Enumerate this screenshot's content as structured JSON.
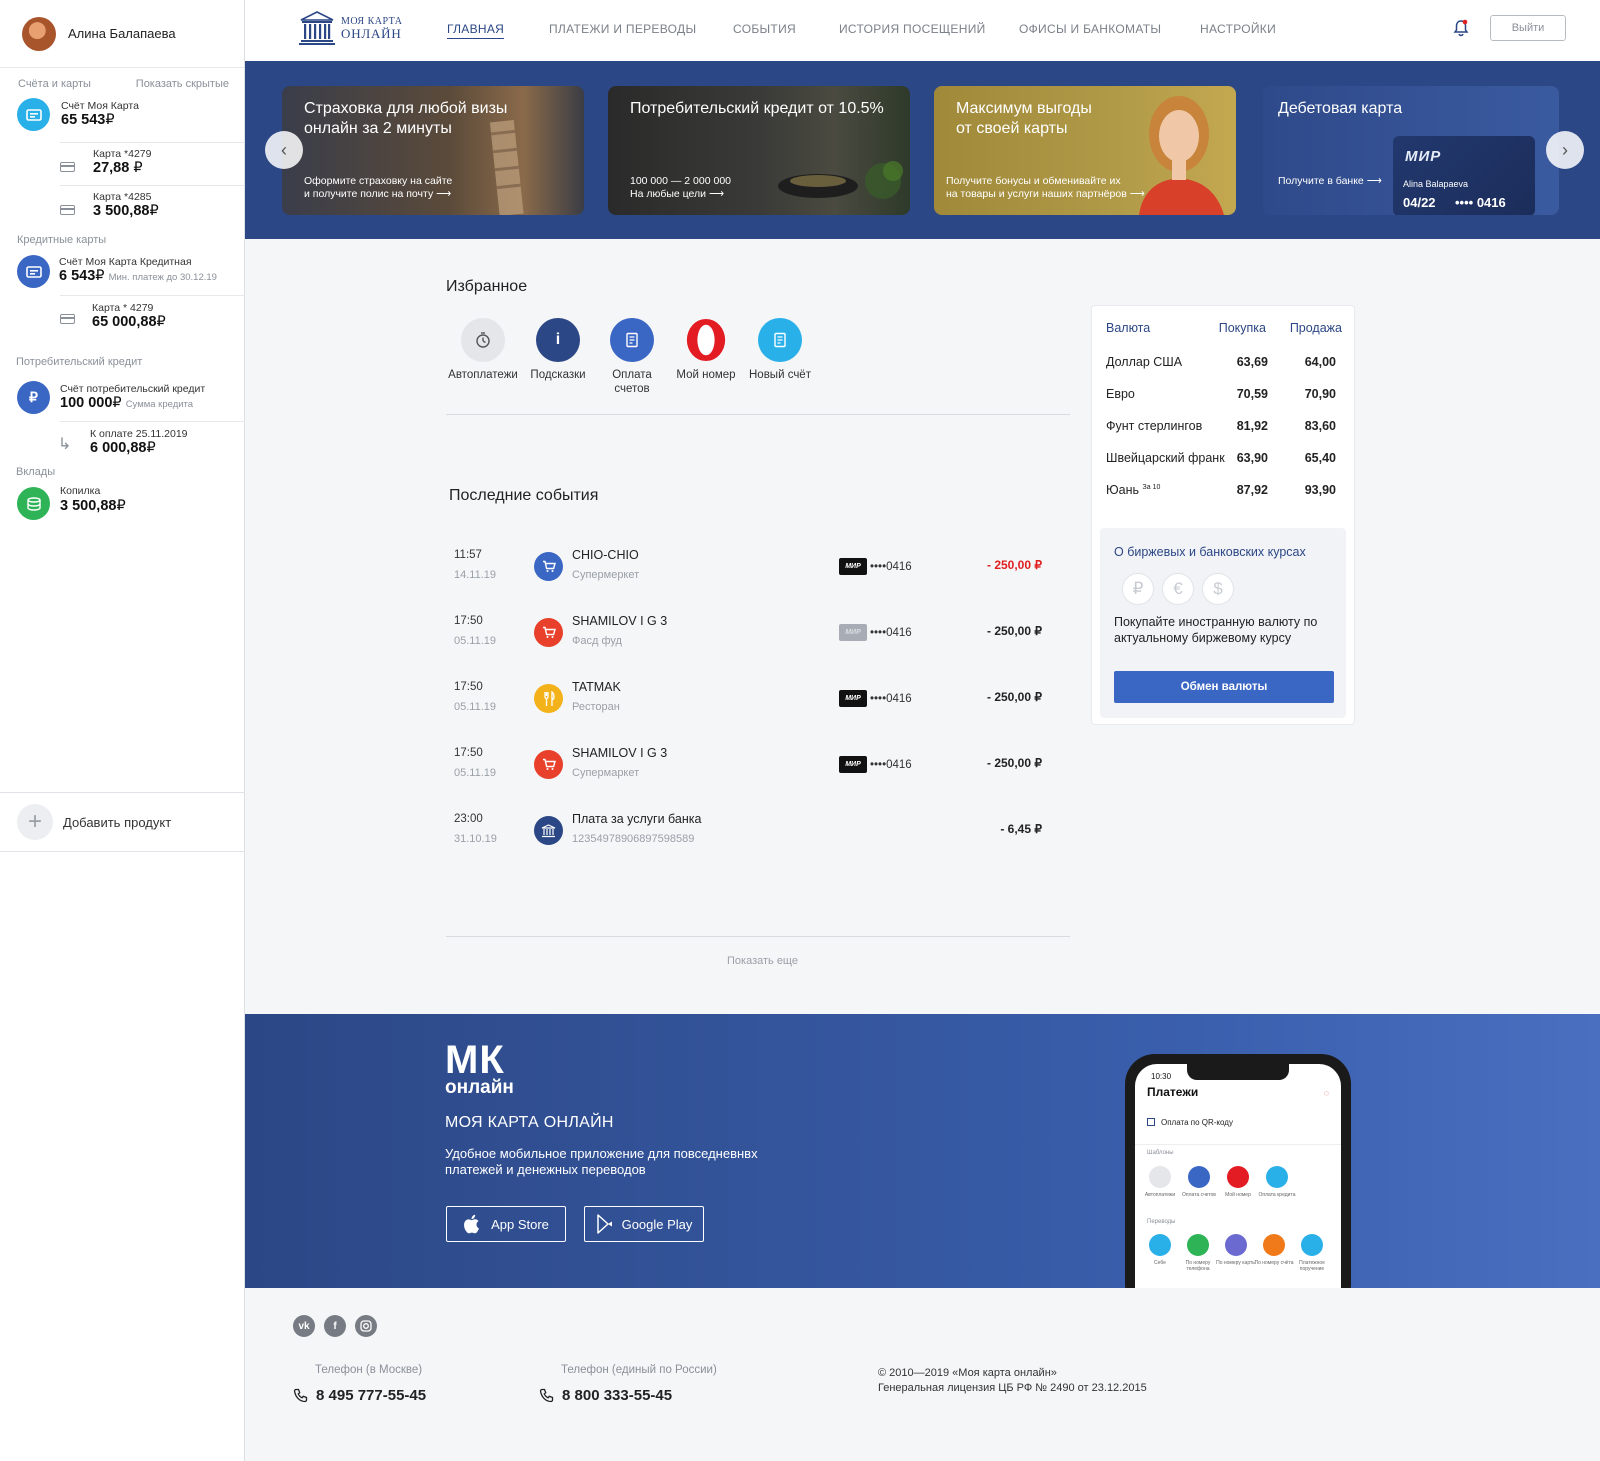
{
  "profile": {
    "name": "Алина Балапаева"
  },
  "sidebar": {
    "accounts_header": "Счёта и карты",
    "show_hidden": "Показать скрытые",
    "main_account": {
      "title": "Счёт Моя Карта",
      "amount": "65 543"
    },
    "cards": [
      {
        "title": "Карта *4279",
        "amount": "27,88"
      },
      {
        "title": "Карта *4285",
        "amount": "3 500,88"
      }
    ],
    "credit_header": "Кредитные карты",
    "credit_account": {
      "title": "Счёт Моя Карта Кредитная",
      "amount": "6 543",
      "note": "Мин. платеж до 30.12.19"
    },
    "credit_card": {
      "title": "Карта * 4279",
      "amount": "65 000,88"
    },
    "loan_header": "Потребительский кредит",
    "loan_account": {
      "title": "Счёт потребительский кредит",
      "amount": "100 000",
      "note": "Сумма кредита"
    },
    "loan_payment": {
      "title": "К оплате 25.11.2019",
      "amount": "6 000,88"
    },
    "deposits_header": "Вклады",
    "deposit": {
      "title": "Копилка",
      "amount": "3 500,88"
    },
    "add_product": "Добавить продукт",
    "currency_symbol": "₽"
  },
  "nav": {
    "logo_line1": "МОЯ КАРТА",
    "logo_line2": "ОНЛАЙН",
    "items": [
      "ГЛАВНАЯ",
      "ПЛАТЕЖИ И ПЕРЕВОДЫ",
      "СОБЫТИЯ",
      "ИСТОРИЯ ПОСЕЩЕНИЙ",
      "ОФИСЫ И БАНКОМАТЫ",
      "НАСТРОЙКИ"
    ],
    "logout": "Выйти"
  },
  "banners": [
    {
      "title": "Страховка для любой визы онлайн за 2 минуты",
      "sub1": "Оформите страховку на сайте",
      "sub2": "и получите полис на почту"
    },
    {
      "title": "Потребительский кредит от 10.5%",
      "sub1": "100 000 — 2 000 000",
      "sub2": "На любые цели"
    },
    {
      "title1": "Максимум выгоды",
      "title2": "от своей карты",
      "sub1": "Получите бонусы и обменивайте их",
      "sub2": "на товары и услуги наших партнёров"
    },
    {
      "title": "Дебетовая карта",
      "sub1": "Получите в банке",
      "card_brand": "МИР",
      "card_holder": "Alina Balapaeva",
      "card_exp": "04/22",
      "card_num": "•••• 0416"
    }
  ],
  "favorites": {
    "title": "Избранное",
    "items": [
      {
        "label": "Автоплатежи",
        "color": "#e4e6ea"
      },
      {
        "label": "Подсказки",
        "color": "#2c4785"
      },
      {
        "label": "Оплата счетов",
        "color": "#3a66c4"
      },
      {
        "label": "Мой номер",
        "color": "#e31b23"
      },
      {
        "label": "Новый счёт",
        "color": "#2ab0e8"
      }
    ]
  },
  "events": {
    "title": "Последние события",
    "items": [
      {
        "time": "11:57",
        "date": "14.11.19",
        "name": "CHIO-CHIO",
        "category": "Супермеркет",
        "card": "••••0416",
        "amount": "- 250,00 ₽",
        "color": "#3a66c4"
      },
      {
        "time": "17:50",
        "date": "05.11.19",
        "name": "SHAMILOV I G 3",
        "category": "Фасд фуд",
        "card": "••••0416",
        "amount": "- 250,00 ₽",
        "color": "#e8402a"
      },
      {
        "time": "17:50",
        "date": "05.11.19",
        "name": "TATMAK",
        "category": "Ресторан",
        "card": "••••0416",
        "amount": "- 250,00 ₽",
        "color": "#f4b21a"
      },
      {
        "time": "17:50",
        "date": "05.11.19",
        "name": "SHAMILOV I G 3",
        "category": "Супермаркет",
        "card": "••••0416",
        "amount": "- 250,00 ₽",
        "color": "#e8402a"
      },
      {
        "time": "23:00",
        "date": "31.10.19",
        "name": "Плата за услуги банка",
        "category": "12354978906897598589",
        "card": "",
        "amount": "- 6,45 ₽",
        "color": "#2c4785"
      }
    ],
    "card_brand": "МИР",
    "show_more": "Показать еще"
  },
  "currency": {
    "head_currency": "Валюта",
    "head_buy": "Покупка",
    "head_sell": "Продажа",
    "rows": [
      {
        "name": "Доллар США",
        "buy": "63,69",
        "sell": "64,00"
      },
      {
        "name": "Евро",
        "buy": "70,59",
        "sell": "70,90"
      },
      {
        "name": "Фунт стерлингов",
        "buy": "81,92",
        "sell": "83,60"
      },
      {
        "name": "Швейцарский франк",
        "buy": "63,90",
        "sell": "65,40"
      },
      {
        "name": "Юань",
        "note": "За 10",
        "buy": "87,92",
        "sell": "93,90"
      }
    ],
    "info_title": "О биржевых и банковских курсах",
    "info_text": "Покупайте иностранную валюту по актуальному биржевому курсу",
    "button": "Обмен валюты"
  },
  "app_promo": {
    "logo_big": "МК",
    "logo_small": "онлайн",
    "title": "МОЯ КАРТА ОНЛАЙН",
    "desc1": "Удобное мобильное  приложение для повседневнвх",
    "desc2": "платежей и денежных переводов",
    "app_store": "App Store",
    "google_play": "Google Play",
    "phone": {
      "time": "10:30",
      "title": "Платежи",
      "qr": "Оплата по QR-коду",
      "templates": "Шаблоны",
      "template_items": [
        "Автоплатежи",
        "Оплата счетов",
        "Мой номер",
        "Оплата кредита"
      ],
      "transfers": "Переводы",
      "transfer_items": [
        "Себе",
        "По номеру телефона",
        "По номеру карты",
        "По номеру счёта",
        "Платежное поручение"
      ]
    }
  },
  "footer": {
    "phone_moscow_label": "Телефон (в Москве)",
    "phone_moscow": "8 495 777-55-45",
    "phone_russia_label": "Телефон (единый по России)",
    "phone_russia": "8 800 333-55-45",
    "copyright1": "© 2010—2019 «Моя карта онлайн»",
    "copyright2": "Генеральная лицензия ЦБ РФ № 2490 от 23.12.2015"
  }
}
